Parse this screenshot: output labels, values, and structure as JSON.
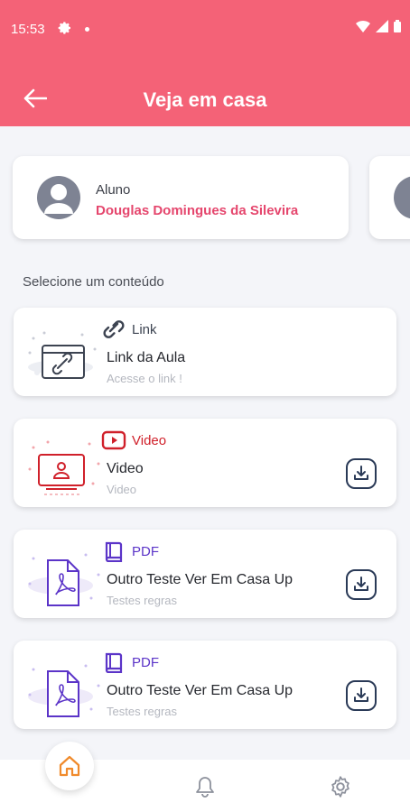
{
  "status_bar": {
    "time": "15:53"
  },
  "app_bar": {
    "title": "Veja em casa"
  },
  "student": {
    "role": "Aluno",
    "name": "Douglas Domingues da Silevira"
  },
  "section_title": "Selecione um conteúdo",
  "colors": {
    "accent": "#f46277",
    "name": "#e5466d",
    "video": "#d0202a",
    "pdf": "#5b34c8",
    "link": "#3c4351"
  },
  "contents": [
    {
      "type": "Link",
      "title": "Link da Aula",
      "subtitle": "Acesse o link !",
      "icon": "link-icon",
      "downloadable": false
    },
    {
      "type": "Video",
      "title": "Video",
      "subtitle": "Video",
      "icon": "youtube-icon",
      "downloadable": true
    },
    {
      "type": "PDF",
      "title": "Outro Teste Ver Em Casa Up",
      "subtitle": "Testes regras",
      "icon": "book-icon",
      "downloadable": true
    },
    {
      "type": "PDF",
      "title": "Outro Teste Ver Em Casa Up",
      "subtitle": "Testes regras",
      "icon": "book-icon",
      "downloadable": true
    }
  ],
  "nav": {
    "items": [
      "home-icon",
      "bell-icon",
      "settings-icon"
    ],
    "active": "home-icon"
  }
}
